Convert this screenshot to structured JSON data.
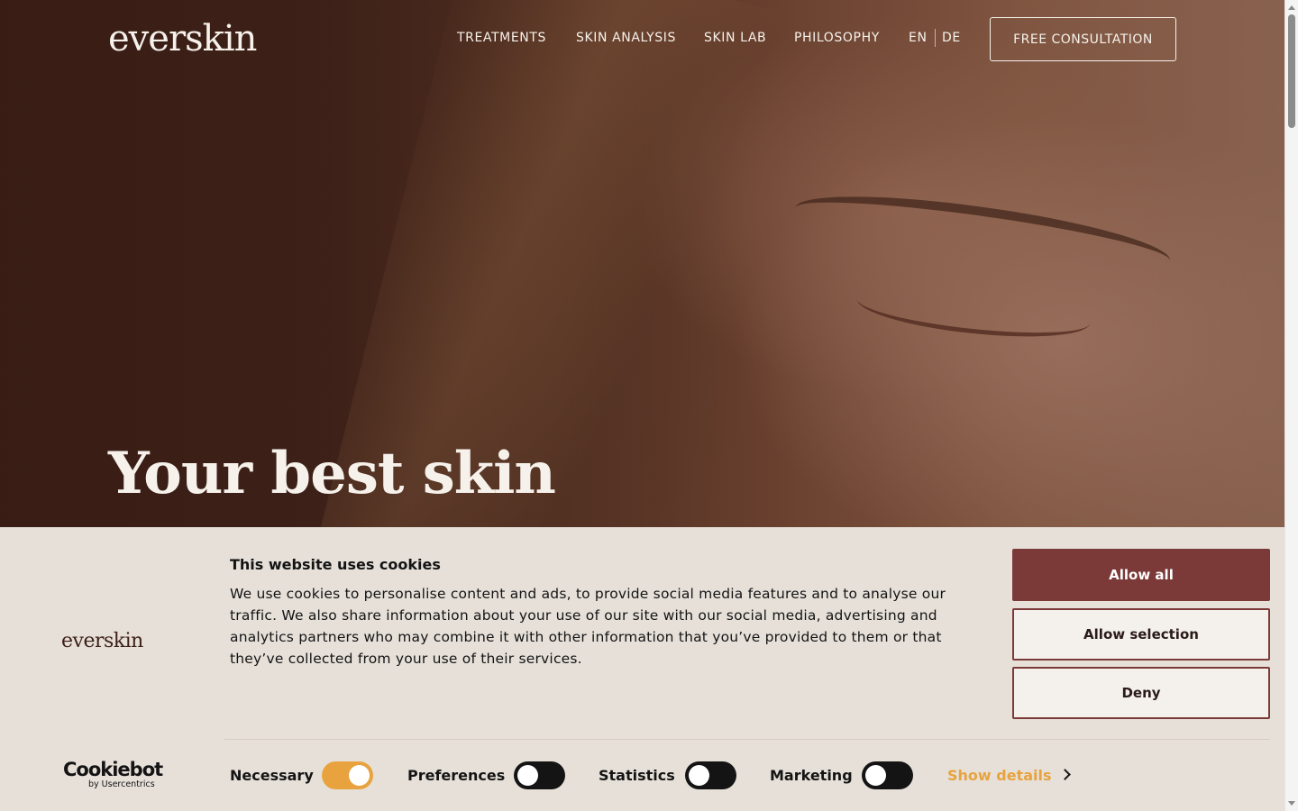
{
  "brand": {
    "logo_text": "everskin"
  },
  "nav": {
    "items": [
      {
        "label": "TREATMENTS"
      },
      {
        "label": "SKIN ANALYSIS"
      },
      {
        "label": "SKIN LAB"
      },
      {
        "label": "PHILOSOPHY"
      }
    ],
    "languages": [
      "EN",
      "DE"
    ],
    "cta_label": "FREE CONSULTATION"
  },
  "hero": {
    "title": "Your best skin"
  },
  "cookie_banner": {
    "logo_text": "everskin",
    "title": "This website uses cookies",
    "body": "We use cookies to personalise content and ads, to provide social media features and to analyse our traffic. We also share information about your use of our site with our social media, advertising and analytics partners who may combine it with other information that you’ve provided to them or that they’ve collected from your use of their services.",
    "buttons": {
      "allow_all": "Allow all",
      "allow_selection": "Allow selection",
      "deny": "Deny"
    },
    "provider": {
      "name": "Cookiebot",
      "sub": "by Usercentrics"
    },
    "toggles": [
      {
        "label": "Necessary",
        "enabled": true
      },
      {
        "label": "Preferences",
        "enabled": false
      },
      {
        "label": "Statistics",
        "enabled": false
      },
      {
        "label": "Marketing",
        "enabled": false
      }
    ],
    "show_details": "Show details"
  },
  "colors": {
    "accent_button": "#7b3a38",
    "toggle_on": "#e8a33f",
    "banner_bg": "#e6e0d9",
    "hero_text": "#f6f1eb"
  }
}
